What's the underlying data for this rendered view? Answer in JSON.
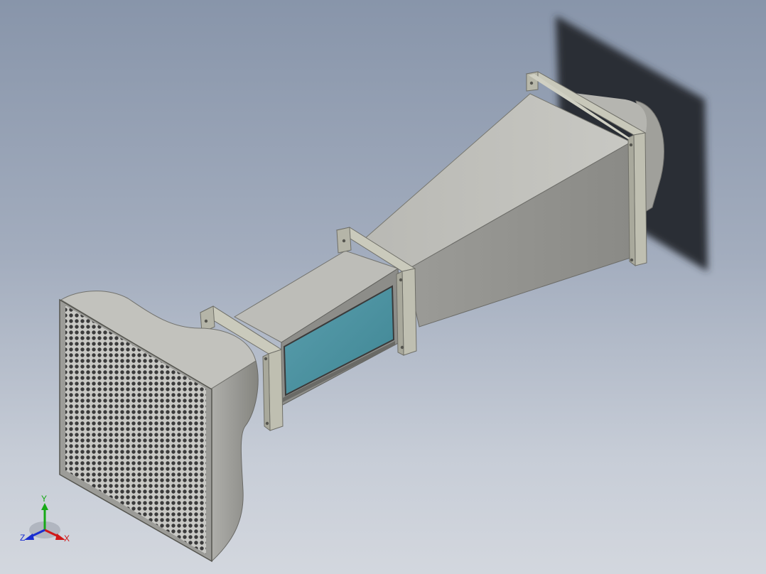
{
  "viewport": {
    "background_top": "#8895aa",
    "background_bottom": "#d3d7de"
  },
  "colors": {
    "body_light": "#c4c4bf",
    "body_mid": "#a9a9a4",
    "body_dark": "#8a8a86",
    "flange": "#bcbcae",
    "window_glass": "#4e93a2",
    "honeycomb_cell": "#3b3b3b",
    "shadow": "#2c2f35"
  },
  "triad": {
    "x_label": "X",
    "y_label": "Y",
    "z_label": "Z",
    "x_color": "#d01818",
    "y_color": "#16a916",
    "z_color": "#1a2ed0"
  }
}
